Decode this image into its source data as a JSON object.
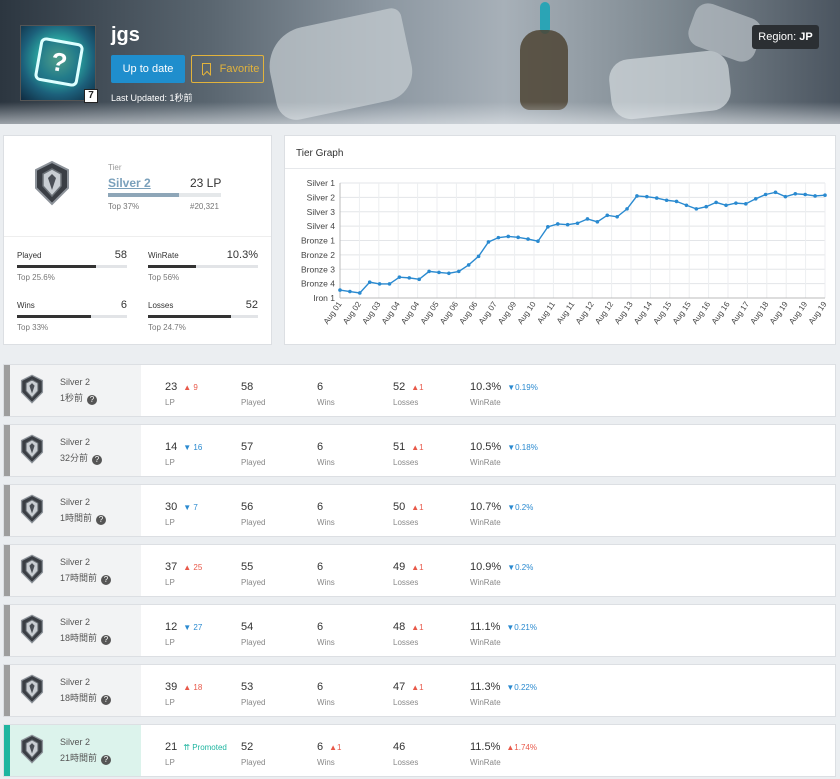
{
  "header": {
    "summoner_name": "jgs",
    "level": "7",
    "update_label": "Up to date",
    "favorite_label": "Favorite",
    "last_updated": "Last Updated: 1秒前",
    "region_label": "Region: ",
    "region_value": "JP"
  },
  "rank": {
    "tier_label": "Tier",
    "tier_name": "Silver 2",
    "lp": "23 LP",
    "top_percent": "Top 37%",
    "rank_number": "#20,321",
    "tier_progress": 0.63
  },
  "stats": [
    {
      "label": "Played",
      "value": "58",
      "sub": "Top 25.6%",
      "fill": 0.72
    },
    {
      "label": "WinRate",
      "value": "10.3%",
      "sub": "Top 56%",
      "fill": 0.44
    },
    {
      "label": "Wins",
      "value": "6",
      "sub": "Top 33%",
      "fill": 0.67
    },
    {
      "label": "Losses",
      "value": "52",
      "sub": "Top 24.7%",
      "fill": 0.75
    }
  ],
  "graph": {
    "title": "Tier Graph"
  },
  "chart_data": {
    "type": "line",
    "title": "Tier Graph",
    "y_ticks": [
      "Iron 1",
      "Bronze 4",
      "Bronze 3",
      "Bronze 2",
      "Bronze 1",
      "Silver 4",
      "Silver 3",
      "Silver 2",
      "Silver 1"
    ],
    "x_ticks": [
      "Aug 01",
      "Aug 02",
      "Aug 03",
      "Aug 04",
      "Aug 04",
      "Aug 05",
      "Aug 06",
      "Aug 06",
      "Aug 07",
      "Aug 09",
      "Aug 10",
      "Aug 11",
      "Aug 11",
      "Aug 12",
      "Aug 12",
      "Aug 13",
      "Aug 14",
      "Aug 15",
      "Aug 15",
      "Aug 16",
      "Aug 16",
      "Aug 17",
      "Aug 18",
      "Aug 19",
      "Aug 19",
      "Aug 19"
    ],
    "series": [
      {
        "values": [
          0.55,
          0.45,
          0.35,
          1.1,
          0.98,
          0.98,
          1.45,
          1.4,
          1.3,
          1.85,
          1.78,
          1.72,
          1.85,
          2.3,
          2.9,
          3.9,
          4.2,
          4.28,
          4.22,
          4.1,
          3.95,
          4.95,
          5.15,
          5.1,
          5.2,
          5.5,
          5.3,
          5.75,
          5.65,
          6.2,
          7.1,
          7.05,
          6.95,
          6.8,
          6.72,
          6.45,
          6.2,
          6.35,
          6.65,
          6.45,
          6.6,
          6.55,
          6.9,
          7.2,
          7.35,
          7.05,
          7.25,
          7.2,
          7.1,
          7.15
        ],
        "color": "#2a8ad0"
      }
    ],
    "ylim": [
      0,
      8
    ],
    "grid": true
  },
  "history": [
    {
      "tier": "Silver 2",
      "time": "1秒前",
      "lp": "23",
      "lp_delta": "9",
      "lp_dir": "up",
      "played": "58",
      "wins": "6",
      "wins_delta": "",
      "losses": "52",
      "losses_delta": "1",
      "winrate": "10.3%",
      "wr_delta": "0.19%",
      "wr_dir": "down",
      "promo": false
    },
    {
      "tier": "Silver 2",
      "time": "32分前",
      "lp": "14",
      "lp_delta": "16",
      "lp_dir": "down",
      "played": "57",
      "wins": "6",
      "wins_delta": "",
      "losses": "51",
      "losses_delta": "1",
      "winrate": "10.5%",
      "wr_delta": "0.18%",
      "wr_dir": "down",
      "promo": false
    },
    {
      "tier": "Silver 2",
      "time": "1時間前",
      "lp": "30",
      "lp_delta": "7",
      "lp_dir": "down",
      "played": "56",
      "wins": "6",
      "wins_delta": "",
      "losses": "50",
      "losses_delta": "1",
      "winrate": "10.7%",
      "wr_delta": "0.2%",
      "wr_dir": "down",
      "promo": false
    },
    {
      "tier": "Silver 2",
      "time": "17時間前",
      "lp": "37",
      "lp_delta": "25",
      "lp_dir": "up",
      "played": "55",
      "wins": "6",
      "wins_delta": "",
      "losses": "49",
      "losses_delta": "1",
      "winrate": "10.9%",
      "wr_delta": "0.2%",
      "wr_dir": "down",
      "promo": false
    },
    {
      "tier": "Silver 2",
      "time": "18時間前",
      "lp": "12",
      "lp_delta": "27",
      "lp_dir": "down",
      "played": "54",
      "wins": "6",
      "wins_delta": "",
      "losses": "48",
      "losses_delta": "1",
      "winrate": "11.1%",
      "wr_delta": "0.21%",
      "wr_dir": "down",
      "promo": false
    },
    {
      "tier": "Silver 2",
      "time": "18時間前",
      "lp": "39",
      "lp_delta": "18",
      "lp_dir": "up",
      "played": "53",
      "wins": "6",
      "wins_delta": "",
      "losses": "47",
      "losses_delta": "1",
      "winrate": "11.3%",
      "wr_delta": "0.22%",
      "wr_dir": "down",
      "promo": false
    },
    {
      "tier": "Silver 2",
      "time": "21時間前",
      "lp": "21",
      "lp_delta": "Promoted",
      "lp_dir": "promoted",
      "played": "52",
      "wins": "6",
      "wins_delta": "1",
      "losses": "46",
      "losses_delta": "",
      "winrate": "11.5%",
      "wr_delta": "1.74%",
      "wr_dir": "up",
      "promo": true
    }
  ],
  "labels": {
    "lp": "LP",
    "played": "Played",
    "wins": "Wins",
    "losses": "Losses",
    "winrate": "WinRate",
    "help": "?"
  },
  "colors": {
    "accent": "#1f8ecd",
    "favorite": "#e2b33c",
    "up": "#e8594a",
    "down": "#2a8ad0",
    "promoted": "#1fb5a0"
  }
}
